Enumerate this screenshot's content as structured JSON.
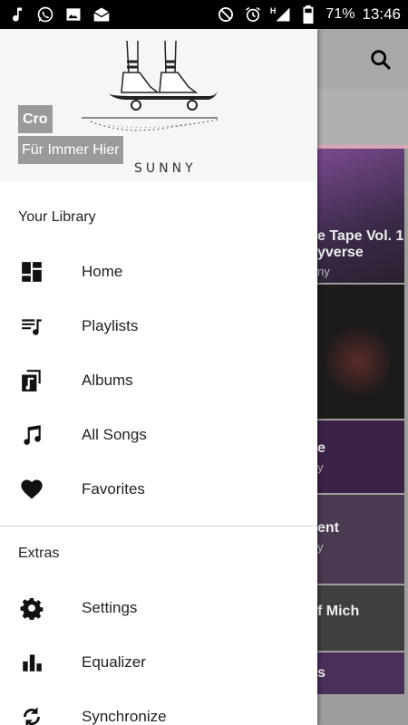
{
  "status_bar": {
    "battery": "71%",
    "time": "13:46",
    "network": "H",
    "left_icons": [
      "music-note-icon",
      "whatsapp-icon",
      "image-icon",
      "mail-icon"
    ],
    "right_icons": [
      "dnd-icon",
      "alarm-icon",
      "signal-icon",
      "battery-icon"
    ]
  },
  "drawer": {
    "header": {
      "artist": "Cro",
      "album": "Für Immer Hier",
      "art_caption": "SUNNY"
    },
    "library_section": "Your Library",
    "library_items": [
      {
        "label": "Home",
        "icon": "dashboard-icon"
      },
      {
        "label": "Playlists",
        "icon": "playlist-icon"
      },
      {
        "label": "Albums",
        "icon": "album-icon"
      },
      {
        "label": "All Songs",
        "icon": "music-note-icon"
      },
      {
        "label": "Favorites",
        "icon": "heart-icon"
      }
    ],
    "extras_section": "Extras",
    "extras_items": [
      {
        "label": "Settings",
        "icon": "gear-icon"
      },
      {
        "label": "Equalizer",
        "icon": "equalizer-icon"
      },
      {
        "label": "Synchronize",
        "icon": "sync-icon"
      }
    ]
  },
  "background": {
    "tiles": [
      {
        "title": "e Tape Vol. 1:",
        "title2": "yverse",
        "subtitle": "ny"
      },
      {
        "title": "",
        "title2": "",
        "subtitle": ""
      },
      {
        "title": "e",
        "title2": "",
        "subtitle": "y"
      },
      {
        "title": "ent",
        "title2": "",
        "subtitle": "y"
      },
      {
        "title": "f Mich",
        "title2": "",
        "subtitle": ""
      },
      {
        "title": "s",
        "title2": "",
        "subtitle": ""
      }
    ],
    "colors": {
      "accent": "#e91e63"
    }
  }
}
